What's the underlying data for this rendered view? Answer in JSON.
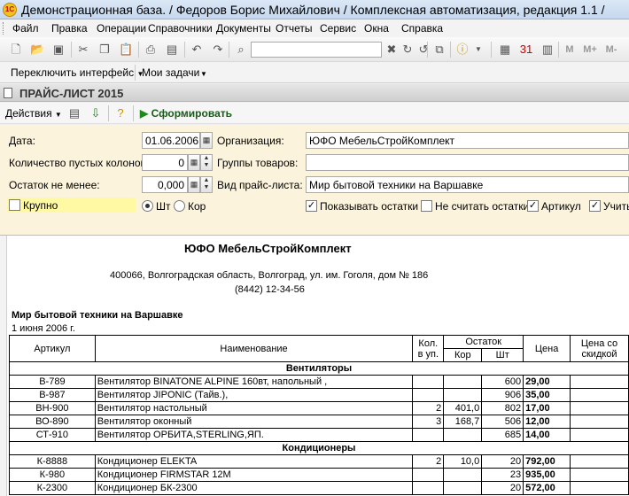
{
  "window": {
    "title": "Демонстрационная база. / Федоров Борис Михайлович /  Комплексная автоматизация, редакция 1.1 /"
  },
  "menu": [
    "Файл",
    "Правка",
    "Операции",
    "Справочники",
    "Документы",
    "Отчеты",
    "Сервис",
    "Окна",
    "Справка"
  ],
  "toolbar2": {
    "switch_interface": "Переключить интерфейс",
    "my_tasks": "Мои задачи",
    "m_labels": [
      "M",
      "M+",
      "M-"
    ]
  },
  "document": {
    "title": "ПРАЙС-ЛИСТ 2015"
  },
  "formbar": {
    "actions": "Действия",
    "generate": "Сформировать"
  },
  "form": {
    "date_label": "Дата:",
    "date_value": "01.06.2006",
    "org_label": "Организация:",
    "org_value": "ЮФО МебельСтройКомплект",
    "empty_cols_label": "Количество пустых колонок:",
    "empty_cols_value": "0",
    "groups_label": "Группы товаров:",
    "groups_value": "",
    "min_stock_label": "Остаток не менее:",
    "min_stock_value": "0,000",
    "pricelist_type_label": "Вид прайс-листа:",
    "pricelist_type_value": "Мир бытовой техники на Варшавке",
    "large_label": "Крупно",
    "unit_sht": "Шт",
    "unit_kor": "Кор",
    "show_stock_label": "Показывать остатки",
    "ignore_stock_label": "Не считать остатки",
    "article_label": "Артикул",
    "consider_label": "Учить"
  },
  "report": {
    "org": "ЮФО МебельСтройКомплект",
    "address": "400066, Волгоградская область, Волгоград, ул. им. Гоголя, дом № 186",
    "phone": "(8442) 12-34-56",
    "pricelist_name": "Мир бытовой техники на Варшавке",
    "date": "1 июня 2006 г.",
    "headers": {
      "article": "Артикул",
      "name": "Наименование",
      "qty1": "Кол.",
      "qty2": "в уп.",
      "stock": "Остаток",
      "kor": "Кор",
      "sht": "Шт",
      "price": "Цена",
      "disc1": "Цена со",
      "disc2": "скидкой"
    },
    "groups": [
      {
        "name": "Вентиляторы",
        "rows": [
          {
            "article": "В-789",
            "name": "Вентилятор BINATONE ALPINE 160вт, напольный ,",
            "pack": "",
            "kor": "",
            "sht": "600",
            "price": "29,00"
          },
          {
            "article": "В-987",
            "name": "Вентилятор JIPONIC (Тайв.),",
            "pack": "",
            "kor": "",
            "sht": "906",
            "price": "35,00"
          },
          {
            "article": "ВН-900",
            "name": "Вентилятор настольный",
            "pack": "2",
            "kor": "401,0",
            "sht": "802",
            "price": "17,00"
          },
          {
            "article": "ВО-890",
            "name": "Вентилятор оконный",
            "pack": "3",
            "kor": "168,7",
            "sht": "506",
            "price": "12,00"
          },
          {
            "article": "СТ-910",
            "name": "Вентилятор ОРБИТА,STERLING,ЯП.",
            "pack": "",
            "kor": "",
            "sht": "685",
            "price": "14,00"
          }
        ]
      },
      {
        "name": "Кондиционеры",
        "rows": [
          {
            "article": "К-8888",
            "name": "Кондиционер ELEKTA",
            "pack": "2",
            "kor": "10,0",
            "sht": "20",
            "price": "792,00"
          },
          {
            "article": "К-980",
            "name": "Кондиционер FIRMSTAR 12M",
            "pack": "",
            "kor": "",
            "sht": "23",
            "price": "935,00"
          },
          {
            "article": "К-2300",
            "name": "Кондиционер БК-2300",
            "pack": "",
            "kor": "",
            "sht": "20",
            "price": "572,00"
          }
        ]
      }
    ]
  }
}
